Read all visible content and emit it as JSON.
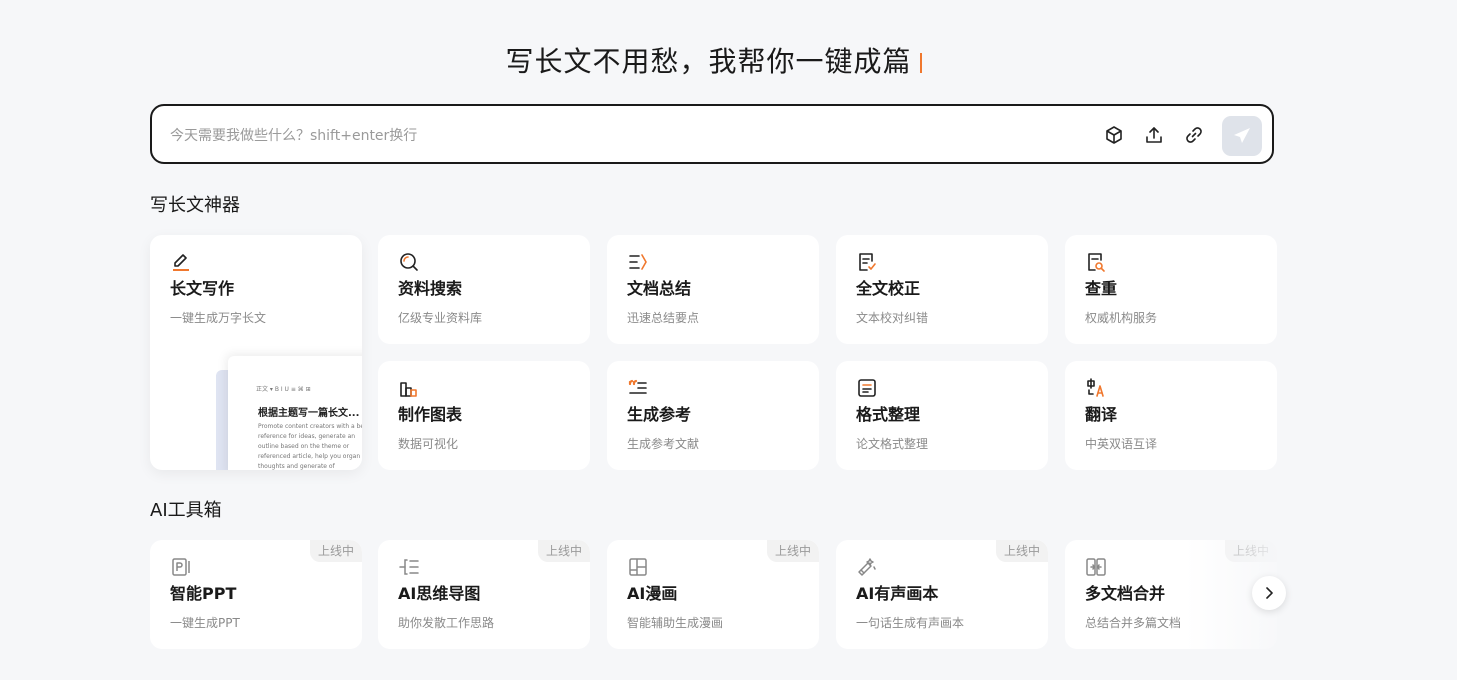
{
  "hero": {
    "title": "写长文不用愁，我帮你一键成篇"
  },
  "chat": {
    "placeholder": "今天需要我做些什么？shift+enter换行",
    "tools": [
      "cube-icon",
      "upload-icon",
      "link-icon",
      "send-icon"
    ]
  },
  "sections": {
    "writing_title": "写长文神器",
    "ai_tools_title": "AI工具箱"
  },
  "writing_tools": [
    {
      "title": "长文写作",
      "desc": "一键生成万字长文",
      "icon": "pen-icon"
    },
    {
      "title": "资料搜索",
      "desc": "亿级专业资料库",
      "icon": "search-icon"
    },
    {
      "title": "文档总结",
      "desc": "迅速总结要点",
      "icon": "summary-icon"
    },
    {
      "title": "全文校正",
      "desc": "文本校对纠错",
      "icon": "proofread-icon"
    },
    {
      "title": "查重",
      "desc": "权威机构服务",
      "icon": "plagiarism-check-icon"
    },
    {
      "title": "制作图表",
      "desc": "数据可视化",
      "icon": "chart-icon"
    },
    {
      "title": "生成参考",
      "desc": "生成参考文献",
      "icon": "quote-icon"
    },
    {
      "title": "格式整理",
      "desc": "论文格式整理",
      "icon": "format-icon"
    },
    {
      "title": "翻译",
      "desc": "中英双语互译",
      "icon": "translate-icon"
    }
  ],
  "preview": {
    "toolbar": "正文 ▾  B  I  U  ≡  ⌘  ⊞",
    "title": "根据主题写一篇长文...",
    "text": "Promote content creators with a better reference for ideas, generate an outline based on the theme or referenced article, help you organ your thoughts and generate of"
  },
  "ai_tools": [
    {
      "title": "智能PPT",
      "desc": "一键生成PPT",
      "badge": "上线中",
      "icon": "ppt-icon"
    },
    {
      "title": "AI思维导图",
      "desc": "助你发散工作思路",
      "badge": "上线中",
      "icon": "mindmap-icon"
    },
    {
      "title": "AI漫画",
      "desc": "智能辅助生成漫画",
      "badge": "上线中",
      "icon": "comic-icon"
    },
    {
      "title": "AI有声画本",
      "desc": "一句话生成有声画本",
      "badge": "上线中",
      "icon": "audiobook-icon"
    },
    {
      "title": "多文档合并",
      "desc": "总结合并多篇文档",
      "badge": "上线中",
      "icon": "merge-icon"
    }
  ],
  "colors": {
    "accent": "#f0782e",
    "text": "#1a1a1a",
    "muted": "#8a8a8a",
    "background": "#f6f7f9"
  }
}
